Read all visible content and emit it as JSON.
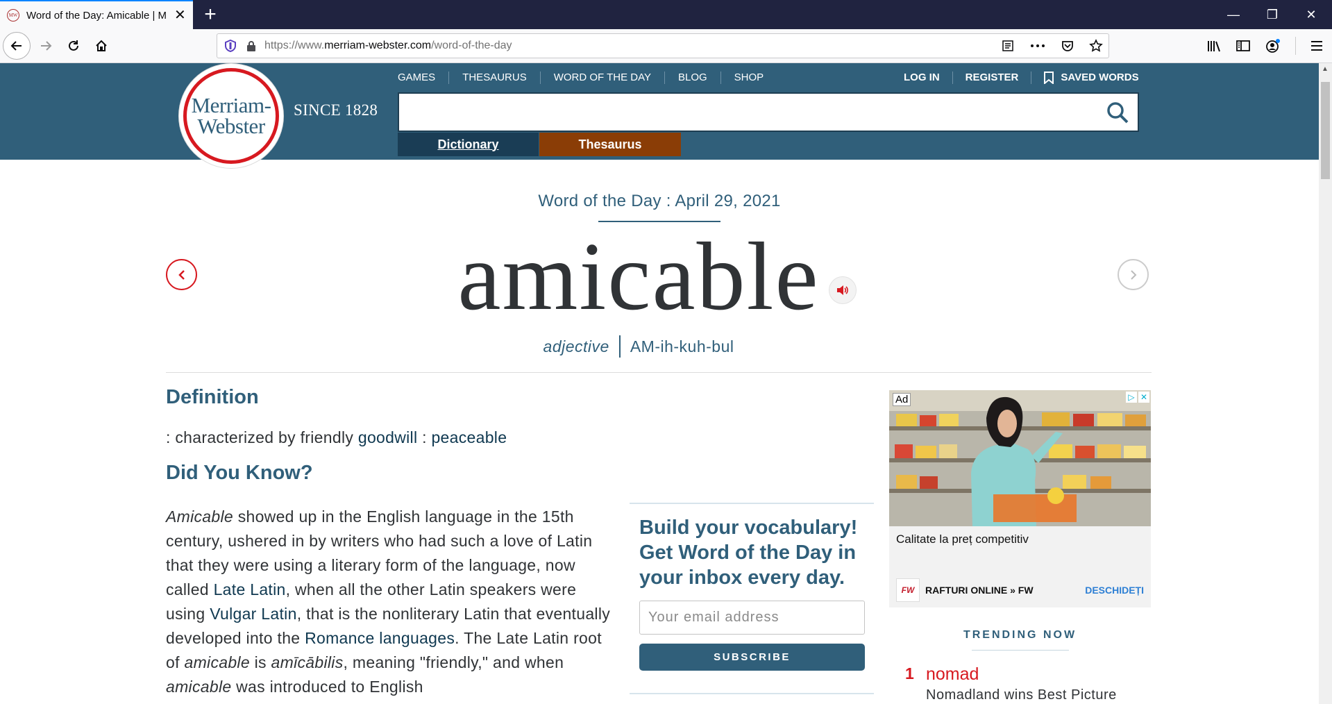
{
  "browser": {
    "tab_title": "Word of the Day: Amicable | M",
    "favicon_text": "MW",
    "url_prefix": "https://www.",
    "url_domain": "merriam-webster.com",
    "url_path": "/word-of-the-day"
  },
  "site": {
    "logo_line1": "Merriam-",
    "logo_line2": "Webster",
    "since": "SINCE 1828",
    "nav": [
      "GAMES",
      "THESAURUS",
      "WORD OF THE DAY",
      "BLOG",
      "SHOP"
    ],
    "login": "LOG IN",
    "register": "REGISTER",
    "saved_words": "SAVED WORDS",
    "tab_dictionary": "Dictionary",
    "tab_thesaurus": "Thesaurus"
  },
  "wod": {
    "title": "Word of the Day : April 29, 2021",
    "word": "amicable",
    "part_of_speech": "adjective",
    "pronunciation": "AM-ih-kuh-bul"
  },
  "definition": {
    "heading": "Definition",
    "prefix": ": characterized by friendly ",
    "link1": "goodwill",
    "sep": " : ",
    "link2": "peaceable"
  },
  "did_you_know": {
    "heading": "Did You Know?",
    "p_word1": "Amicable",
    "p_text1": " showed up in the English language in the 15th century, ushered in by writers who had such a love of Latin that they were using a literary form of the language, now called ",
    "p_link1": "Late Latin",
    "p_text2": ", when all the other Latin speakers were using ",
    "p_link2": "Vulgar Latin",
    "p_text3": ", that is the nonliterary Latin that eventually developed into the ",
    "p_link3": "Romance languages",
    "p_text4": ". The Late Latin root of ",
    "p_word2": "amicable",
    "p_text5": " is ",
    "p_word3": "amīcābilis",
    "p_text6": ", meaning \"friendly,\" and when ",
    "p_word4": "amicable",
    "p_text7": " was introduced to English"
  },
  "newsletter": {
    "title": "Build your vocabulary! Get Word of the Day in your inbox every day.",
    "email_placeholder": "Your email address",
    "subscribe": "SUBSCRIBE"
  },
  "ad": {
    "tag": "Ad",
    "caption": "Calitate la preț competitiv",
    "brand_logo": "FW",
    "brand": "RAFTURI ONLINE » FW",
    "cta": "DESCHIDEȚI"
  },
  "trending": {
    "title": "TRENDING NOW",
    "items": [
      {
        "rank": "1",
        "word": "nomad",
        "desc": "Nomadland wins Best Picture"
      }
    ]
  },
  "colors": {
    "header_bg": "#305f7a",
    "accent_red": "#d71920",
    "dict_tab": "#1a3d55",
    "thes_tab": "#8a3d06"
  }
}
